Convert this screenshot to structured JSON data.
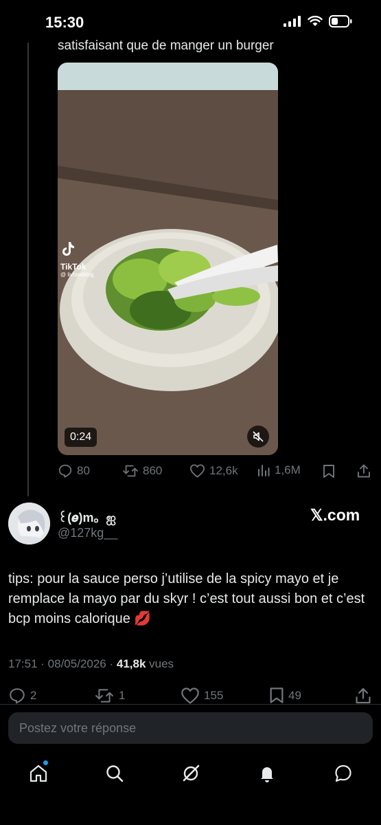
{
  "status_bar": {
    "time": "15:30"
  },
  "quoted_tweet": {
    "text_fragment": "satisfaisant que de manger un burger",
    "video": {
      "duration": "0:24",
      "watermark_brand": "TikTok",
      "watermark_handle": "@ livfoodblog"
    },
    "stats": {
      "replies": "80",
      "reposts": "860",
      "likes": "12,6k",
      "views": "1,6M"
    }
  },
  "tweet": {
    "display_name": "꒰(𝒆)m。ஐ",
    "handle": "@127kg__",
    "source_badge": "𝕏.com",
    "text": "tips: pour la sauce perso j’utilise de la spicy mayo et je remplace la mayo par du skyr ! c’est tout aussi bon et c’est bcp moins calorique 💋",
    "time": "17:51",
    "date": "08/05/2026",
    "views_count": "41,8k",
    "views_label": "vues",
    "stats": {
      "replies": "2",
      "reposts": "1",
      "likes": "155",
      "bookmarks": "49"
    }
  },
  "reply_box": {
    "placeholder": "Postez votre réponse"
  },
  "nav": {
    "items": [
      "home-icon",
      "search-icon",
      "grok-icon",
      "notifications-icon",
      "messages-icon"
    ]
  },
  "colors": {
    "background": "#000000",
    "text": "#e7e9ea",
    "muted": "#71767b",
    "accent": "#1d9bf0"
  }
}
